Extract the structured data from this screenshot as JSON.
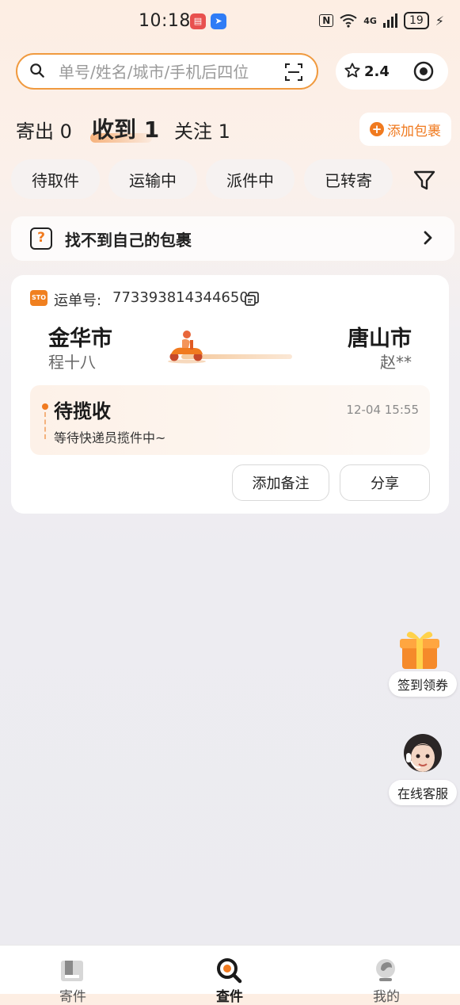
{
  "status_bar": {
    "time": "10:18",
    "nfc": "N",
    "wifi_label": "6",
    "network": "4G",
    "battery": "19"
  },
  "search": {
    "placeholder": "单号/姓名/城市/手机后四位",
    "value": ""
  },
  "points": {
    "value": "2.4"
  },
  "tabs": [
    {
      "label": "寄出 0"
    },
    {
      "label": "收到 1"
    },
    {
      "label": "关注 1"
    }
  ],
  "add_parcel_label": "添加包裹",
  "filters": [
    "待取件",
    "运输中",
    "派件中",
    "已转寄"
  ],
  "help_banner": {
    "text": "找不到自己的包裹",
    "icon_char": "?"
  },
  "parcel": {
    "carrier_logo": "STO",
    "waybill_label": "运单号:",
    "waybill_no": "773393814344650",
    "origin_city": "金华市",
    "origin_person": "程十八",
    "dest_city": "唐山市",
    "dest_person": "赵**",
    "status_title": "待揽收",
    "status_time": "12-04 15:55",
    "status_desc": "等待快递员揽件中~",
    "btn_note": "添加备注",
    "btn_share": "分享"
  },
  "floating": {
    "checkin_label": "签到领券",
    "service_label": "在线客服"
  },
  "bottom_nav": [
    {
      "label": "寄件"
    },
    {
      "label": "查件"
    },
    {
      "label": "我的"
    }
  ],
  "colors": {
    "accent": "#f07a1f",
    "search_border": "#f09a3f"
  }
}
